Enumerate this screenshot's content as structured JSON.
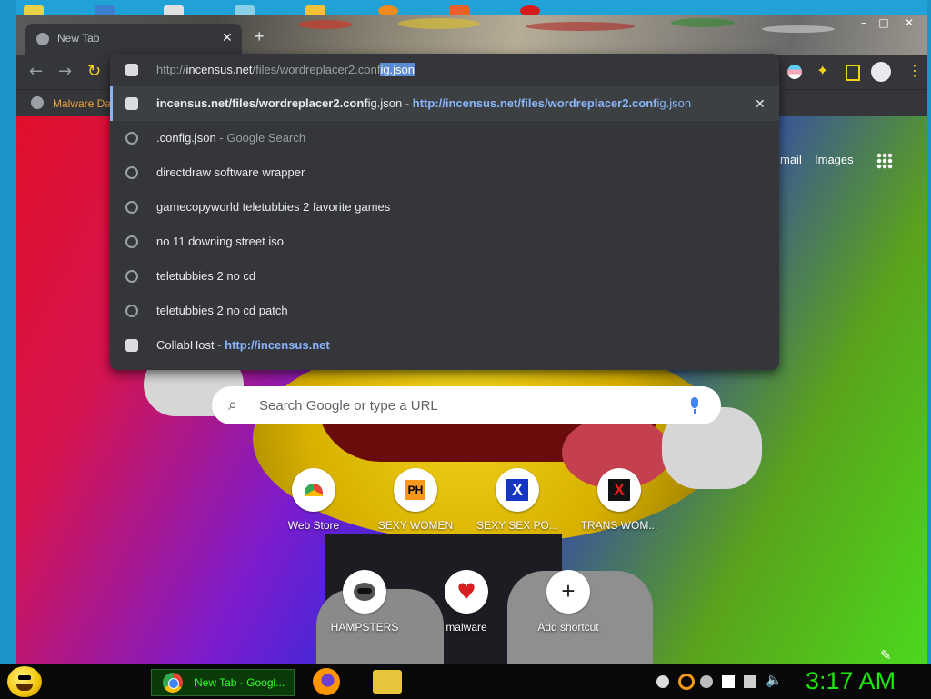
{
  "browser": {
    "tab_title": "New Tab",
    "bookmark_label": "Malware Da",
    "omnibox": {
      "url_prefix": "http://",
      "url_host": "incensus.net",
      "url_path_plain": "/files/wordreplacer2.conf",
      "url_selected": "ig.json"
    },
    "suggestions": [
      {
        "type": "history-url",
        "icon": "site-icon",
        "bold": "incensus.net/files/wordreplacer2.conf",
        "plain": "ig.json",
        "sep": " - ",
        "link_bold": "http://incensus.net/files/wordreplacer2.conf",
        "link_plain": "ig.json",
        "selected": true
      },
      {
        "type": "search",
        "icon": "clock-icon",
        "main": ".config.json",
        "sep": " - ",
        "secondary": "Google Search"
      },
      {
        "type": "history",
        "icon": "clock-icon",
        "main": "directdraw software wrapper"
      },
      {
        "type": "history",
        "icon": "clock-icon",
        "main": "gamecopyworld teletubbies 2 favorite games"
      },
      {
        "type": "history",
        "icon": "clock-icon",
        "main": "no 11 downing street iso"
      },
      {
        "type": "history",
        "icon": "clock-icon",
        "main": "teletubbies 2 no cd"
      },
      {
        "type": "history",
        "icon": "clock-icon",
        "main": "teletubbies 2 no cd patch"
      },
      {
        "type": "site",
        "icon": "site-icon",
        "main": "CollabHost",
        "sep": " - ",
        "link": "http://incensus.net"
      }
    ]
  },
  "newtab": {
    "top_links": {
      "gmail": "mail",
      "images": "Images"
    },
    "search_placeholder": "Search Google or type a URL",
    "shortcuts_row1": [
      {
        "label": "Web Store",
        "icon": "webstore-icon"
      },
      {
        "label": "SEXY WOMEN",
        "icon": "ph-icon",
        "glyph": "PH"
      },
      {
        "label": "SEXY SEX PO...",
        "icon": "x-blue-icon",
        "glyph": "X"
      },
      {
        "label": "TRANS WOM...",
        "icon": "x-red-icon",
        "glyph": "X"
      }
    ],
    "shortcuts_row2": [
      {
        "label": "HAMPSTERS",
        "icon": "raccoon-icon"
      },
      {
        "label": "malware",
        "icon": "heart-icon",
        "glyph": "♥"
      },
      {
        "label": "Add shortcut",
        "icon": "plus-icon",
        "glyph": "+"
      }
    ]
  },
  "taskbar": {
    "active_task": "New Tab - Googl...",
    "clock": "3:17 AM"
  },
  "colors": {
    "accent_blue": "#8ab4f8",
    "clock_green": "#1fe60d",
    "chrome_dark": "#35363a"
  }
}
